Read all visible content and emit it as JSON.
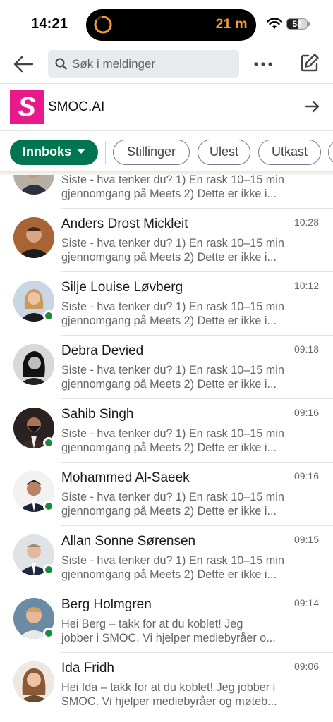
{
  "status_bar": {
    "time": "14:21",
    "timer_text": "21 m",
    "battery": "58",
    "battery_level": 0.58,
    "accent_color": "#f29a3c"
  },
  "header": {
    "back_icon": "arrow-left-icon",
    "search_placeholder": "Søk i meldinger",
    "more_icon": "more-horizontal-icon",
    "compose_icon": "compose-icon"
  },
  "company": {
    "logo_letter": "S",
    "name": "SMOC.AI",
    "logo_color": "#e8198b"
  },
  "filters": {
    "items": [
      {
        "label": "Innboks",
        "active": true
      },
      {
        "label": "Stillinger",
        "active": false
      },
      {
        "label": "Ulest",
        "active": false
      },
      {
        "label": "Utkast",
        "active": false
      }
    ],
    "active_color": "#01754f"
  },
  "messages": [
    {
      "name": "",
      "time": "",
      "preview": "Siste - hva tenker du? 1) En rask 10–15 min\ngjennomgang på Meets 2) Dette er ikke i...",
      "online": false
    },
    {
      "name": "Anders Drost Mickleit",
      "time": "10:28",
      "preview": "Siste - hva tenker du? 1) En rask 10–15 min\ngjennomgang på Meets 2) Dette er ikke i...",
      "online": false
    },
    {
      "name": "Silje Louise Løvberg",
      "time": "10:12",
      "preview": "Siste - hva tenker du? 1) En rask 10–15 min\ngjennomgang på Meets 2) Dette er ikke i...",
      "online": true
    },
    {
      "name": "Debra Devied",
      "time": "09:18",
      "preview": "Siste - hva tenker du? 1) En rask 10–15 min\ngjennomgang på Meets 2) Dette er ikke i...",
      "online": false
    },
    {
      "name": "Sahib Singh",
      "time": "09:16",
      "preview": "Siste - hva tenker du? 1) En rask 10–15 min\ngjennomgang på Meets 2) Dette er ikke i...",
      "online": true
    },
    {
      "name": "Mohammed Al-Saeek",
      "time": "09:16",
      "preview": "Siste - hva tenker du? 1) En rask 10–15 min\ngjennomgang på Meets 2) Dette er ikke i...",
      "online": true
    },
    {
      "name": "Allan Sonne Sørensen",
      "time": "09:15",
      "preview": "Siste - hva tenker du? 1) En rask 10–15 min\ngjennomgang på Meets 2) Dette er ikke i...",
      "online": true
    },
    {
      "name": "Berg Holmgren",
      "time": "09:14",
      "preview": "Hei Berg – takk for at du koblet! Jeg\njobber i SMOC. Vi hjelper mediebyråer o...",
      "online": true
    },
    {
      "name": "Ida Fridh",
      "time": "09:06",
      "preview": "Hei Ida – takk for at du koblet! Jeg jobber i\nSMOC. Vi hjelper mediebyråer og møteb...",
      "online": false
    }
  ]
}
